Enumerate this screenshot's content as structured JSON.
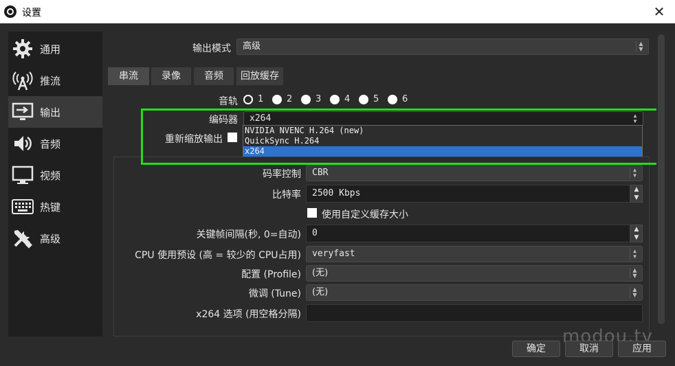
{
  "window": {
    "title": "设置",
    "close_glyph": "✕"
  },
  "sidebar": {
    "items": [
      {
        "label": "通用",
        "icon": "gear-icon"
      },
      {
        "label": "推流",
        "icon": "broadcast-icon"
      },
      {
        "label": "输出",
        "icon": "output-icon"
      },
      {
        "label": "音频",
        "icon": "speaker-icon"
      },
      {
        "label": "视频",
        "icon": "monitor-icon"
      },
      {
        "label": "热键",
        "icon": "keyboard-icon"
      },
      {
        "label": "高级",
        "icon": "tools-icon"
      }
    ],
    "active_index": 2
  },
  "output_mode": {
    "label": "输出模式",
    "value": "高级"
  },
  "tabs": [
    {
      "label": "串流"
    },
    {
      "label": "录像"
    },
    {
      "label": "音频"
    },
    {
      "label": "回放缓存"
    }
  ],
  "audio_track": {
    "label": "音轨",
    "tracks": [
      "1",
      "2",
      "3",
      "4",
      "5",
      "6"
    ],
    "selected": "1"
  },
  "encoder": {
    "label": "编码器",
    "value": "x264",
    "options": [
      "NVIDIA NVENC H.264 (new)",
      "QuickSync H.264",
      "x264"
    ],
    "selected_option": "x264"
  },
  "rescale": {
    "label": "重新缩放输出"
  },
  "rate_control": {
    "label": "码率控制",
    "value": "CBR"
  },
  "bitrate": {
    "label": "比特率",
    "value": "2500 Kbps"
  },
  "custom_buffer": {
    "label": "使用自定义缓存大小"
  },
  "keyframe": {
    "label": "关键帧间隔(秒, 0=自动)",
    "value": "0"
  },
  "cpu_preset": {
    "label": "CPU 使用预设 (高 = 较少的 CPU占用)",
    "value": "veryfast"
  },
  "profile": {
    "label": "配置 (Profile)",
    "value": "(无)"
  },
  "tune": {
    "label": "微调 (Tune)",
    "value": "(无)"
  },
  "x264_options": {
    "label": "x264 选项 (用空格分隔)",
    "value": ""
  },
  "buttons": {
    "ok": "确定",
    "cancel": "取消",
    "apply": "应用"
  },
  "watermark": "modou.tv",
  "colors": {
    "highlight": "#22e014",
    "selection": "#2a73d0"
  }
}
